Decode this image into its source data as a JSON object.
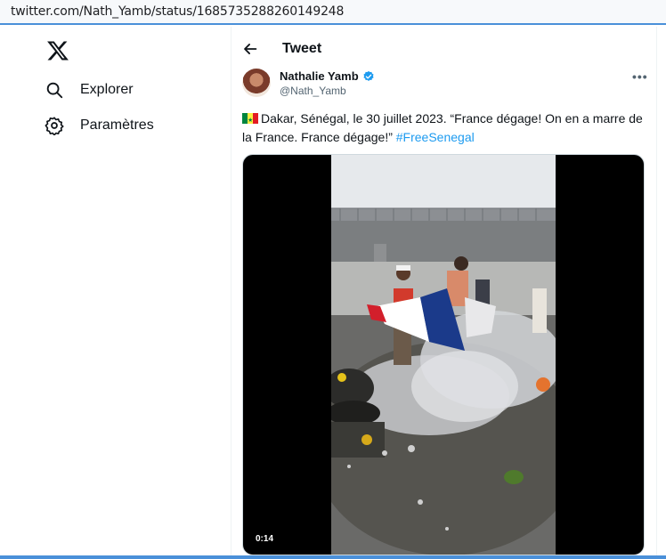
{
  "browser": {
    "url": "twitter.com/Nath_Yamb/status/1685735288260149248"
  },
  "sidebar": {
    "logo": "x-logo-icon",
    "items": [
      {
        "label": "Explorer",
        "icon": "search-icon"
      },
      {
        "label": "Paramètres",
        "icon": "gear-icon"
      }
    ]
  },
  "header": {
    "title": "Tweet",
    "back_icon": "arrow-left-icon"
  },
  "tweet": {
    "author_name": "Nathalie Yamb",
    "author_handle": "@Nath_Yamb",
    "verified": true,
    "text_main": "Dakar, Sénégal, le 30 juillet 2023. “France dégage! On en a marre de la France. France dégage!”",
    "hashtag": "#FreeSenegal",
    "flag": "senegal-flag-icon",
    "media": {
      "duration": "0:14"
    }
  },
  "colors": {
    "accent": "#1d9bf0",
    "text": "#0f1419",
    "secondary": "#536471",
    "browser_accent": "#4a90d9"
  }
}
